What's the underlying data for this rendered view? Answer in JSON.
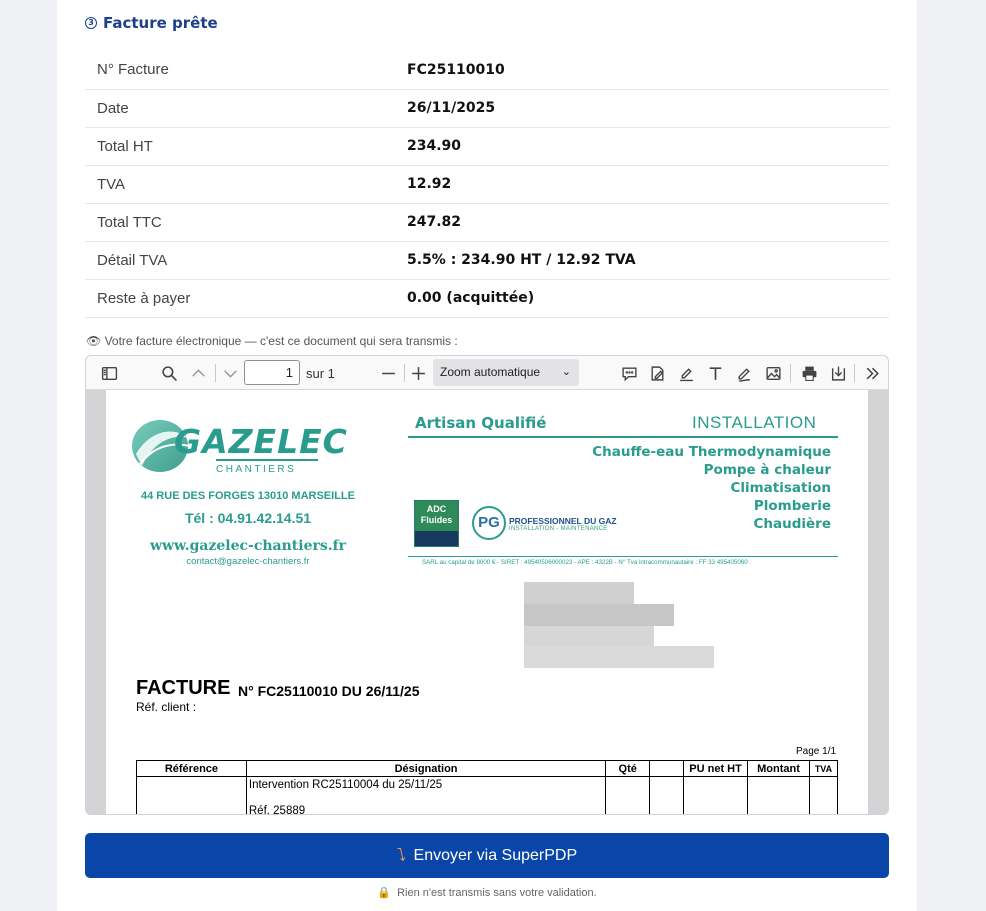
{
  "section": {
    "step": "3",
    "title": "Facture prête"
  },
  "summary": [
    {
      "label": "N° Facture",
      "value": "FC25110010"
    },
    {
      "label": "Date",
      "value": "26/11/2025"
    },
    {
      "label": "Total HT",
      "value": "234.90"
    },
    {
      "label": "TVA",
      "value": "12.92"
    },
    {
      "label": "Total TTC",
      "value": "247.82"
    },
    {
      "label": "Détail TVA",
      "value": "5.5% : 234.90 HT / 12.92 TVA"
    },
    {
      "label": "Reste à payer",
      "value": "0.00 (acquittée)"
    }
  ],
  "preview_label": "👁 Votre facture électronique — c'est ce document qui sera transmis :",
  "viewer": {
    "page_number": "1",
    "of_label": "sur 1",
    "zoom": "Zoom automatique"
  },
  "invoice_doc": {
    "company": "GAZELEC",
    "company_sub": "CHANTIERS",
    "address": "44 RUE DES FORGES 13010 MARSEILLE",
    "tel": "Tél : 04.91.42.14.51",
    "web": "www.gazelec-chantiers.fr",
    "email": "contact@gazelec-chantiers.fr",
    "artisan": "Artisan Qualifié",
    "installation": "INSTALLATION",
    "services": [
      "Chauffe-eau Thermodynamique",
      "Pompe à chaleur",
      "Climatisation",
      "Plomberie",
      "Chaudière"
    ],
    "adc_label": "ADC Fluides",
    "pg_label": "PROFESSIONNEL DU GAZ",
    "pg_sub": "INSTALLATION - MAINTENANCE",
    "legal": "SARL au capital de 8000 € - SIRET : 49540506000023 - APE : 4322B - N° Tva intracommunautaire : FF 33 495405060",
    "title": "FACTURE",
    "number_line": "N° FC25110010 DU 26/11/25",
    "ref_client": "Réf. client :",
    "page_count": "Page 1/1",
    "columns": [
      "Référence",
      "Désignation",
      "Qté",
      "",
      "PU net HT",
      "Montant",
      "TVA"
    ],
    "line1": "Intervention RC25110004 du 25/11/25",
    "line2": "Réf. 25889"
  },
  "send_button": "Envoyer via SuperPDP",
  "notice": "Rien n'est transmis sans votre validation."
}
